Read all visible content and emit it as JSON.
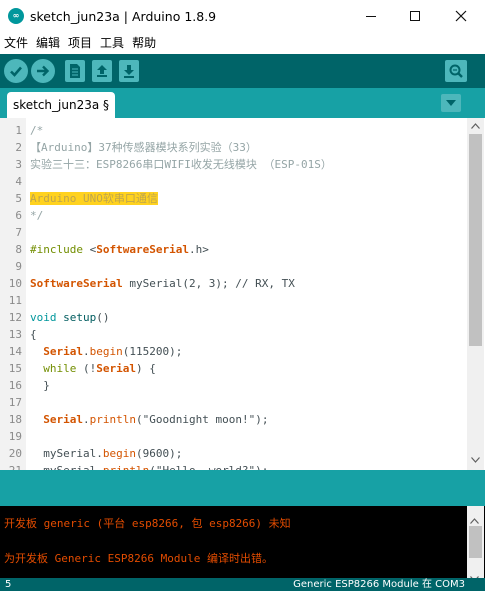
{
  "window": {
    "title": "sketch_jun23a | Arduino 1.8.9"
  },
  "menu": [
    "文件",
    "编辑",
    "项目",
    "工具",
    "帮助"
  ],
  "toolbar": {
    "buttons": [
      "verify-icon",
      "upload-icon",
      "new-icon",
      "open-icon",
      "save-icon"
    ],
    "serial_monitor": "serial-monitor-icon"
  },
  "tabs": [
    {
      "label": "sketch_jun23a §"
    }
  ],
  "editor": {
    "lines": [
      {
        "n": "1",
        "segs": [
          {
            "c": "t-comment",
            "t": "/*"
          }
        ]
      },
      {
        "n": "2",
        "segs": [
          {
            "c": "t-comment",
            "t": "【Arduino】37种传感器模块系列实验（33）"
          }
        ]
      },
      {
        "n": "3",
        "segs": [
          {
            "c": "t-comment",
            "t": "实验三十三：ESP8266串口WIFI收发无线模块 （ESP-01S）"
          }
        ]
      },
      {
        "n": "4",
        "segs": []
      },
      {
        "n": "5",
        "segs": [
          {
            "c": "t-hl",
            "t": "Arduino UNO软串口通信"
          }
        ]
      },
      {
        "n": "6",
        "segs": [
          {
            "c": "t-comment",
            "t": "*/"
          }
        ]
      },
      {
        "n": "7",
        "segs": []
      },
      {
        "n": "8",
        "segs": [
          {
            "c": "t-kw",
            "t": "#include"
          },
          {
            "c": "t-plain",
            "t": " <"
          },
          {
            "c": "t-cls",
            "t": "SoftwareSerial"
          },
          {
            "c": "t-plain",
            "t": ".h>"
          }
        ]
      },
      {
        "n": "9",
        "segs": []
      },
      {
        "n": "10",
        "segs": [
          {
            "c": "t-cls",
            "t": "SoftwareSerial"
          },
          {
            "c": "t-plain",
            "t": " mySerial(2, 3); // RX, TX"
          }
        ]
      },
      {
        "n": "11",
        "segs": []
      },
      {
        "n": "12",
        "segs": [
          {
            "c": "t-type",
            "t": "void"
          },
          {
            "c": "t-plain",
            "t": " "
          },
          {
            "c": "t-str",
            "t": "setup"
          },
          {
            "c": "t-plain",
            "t": "()"
          }
        ]
      },
      {
        "n": "13",
        "segs": [
          {
            "c": "t-plain",
            "t": "{"
          }
        ]
      },
      {
        "n": "14",
        "segs": [
          {
            "c": "t-plain",
            "t": "  "
          },
          {
            "c": "t-cls",
            "t": "Serial"
          },
          {
            "c": "t-plain",
            "t": "."
          },
          {
            "c": "t-fn",
            "t": "begin"
          },
          {
            "c": "t-plain",
            "t": "(115200);"
          }
        ]
      },
      {
        "n": "15",
        "segs": [
          {
            "c": "t-plain",
            "t": "  "
          },
          {
            "c": "t-kw",
            "t": "while"
          },
          {
            "c": "t-plain",
            "t": " (!"
          },
          {
            "c": "t-cls",
            "t": "Serial"
          },
          {
            "c": "t-plain",
            "t": ") {"
          }
        ]
      },
      {
        "n": "16",
        "segs": [
          {
            "c": "t-plain",
            "t": "  }"
          }
        ]
      },
      {
        "n": "17",
        "segs": []
      },
      {
        "n": "18",
        "segs": [
          {
            "c": "t-plain",
            "t": "  "
          },
          {
            "c": "t-cls",
            "t": "Serial"
          },
          {
            "c": "t-plain",
            "t": "."
          },
          {
            "c": "t-fn",
            "t": "println"
          },
          {
            "c": "t-plain",
            "t": "(\"Goodnight moon!\");"
          }
        ]
      },
      {
        "n": "19",
        "segs": []
      },
      {
        "n": "20",
        "segs": [
          {
            "c": "t-plain",
            "t": "  mySerial."
          },
          {
            "c": "t-fn",
            "t": "begin"
          },
          {
            "c": "t-plain",
            "t": "(9600);"
          }
        ]
      },
      {
        "n": "21",
        "segs": [
          {
            "c": "t-plain",
            "t": "  mySerial."
          },
          {
            "c": "t-fn",
            "t": "println"
          },
          {
            "c": "t-plain",
            "t": "(\"Hello, world?\");"
          }
        ]
      }
    ]
  },
  "console": {
    "lines": [
      "开发板 generic (平台 esp8266, 包 esp8266) 未知",
      "",
      "为开发板 Generic ESP8266 Module 编译时出错。"
    ]
  },
  "statusbar": {
    "line_number": "5",
    "board_port": "Generic ESP8266 Module 在 COM3"
  }
}
